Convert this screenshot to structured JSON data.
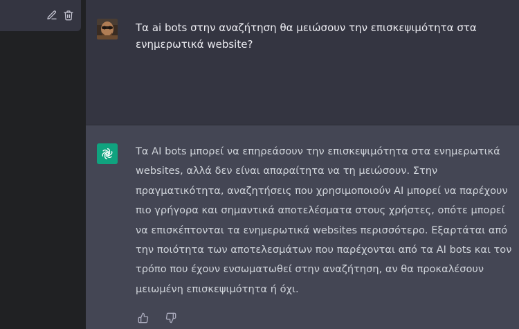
{
  "sidebar": {
    "active_item": {
      "edit_icon": "pencil-icon",
      "delete_icon": "trash-icon"
    }
  },
  "conversation": {
    "user_message": {
      "avatar": "user-avatar-photo",
      "text": "Τα ai bots στην αναζήτηση θα μειώσουν την επισκεψιμότητα στα ενημερωτικά website?"
    },
    "assistant_message": {
      "avatar": "openai-logo-icon",
      "text": "Τα AI bots μπορεί να επηρεάσουν την επισκεψιμότητα στα ενημερωτικά websites, αλλά δεν είναι απαραίτητα να τη μειώσουν. Στην πραγματικότητα, αναζητήσεις που χρησιμοποιούν AI μπορεί να παρέχουν πιο γρήγορα και σημαντικά αποτελέσματα στους χρήστες, οπότε μπορεί να επισκέπτονται τα ενημερωτικά websites περισσότερο. Εξαρτάται από την ποιότητα των αποτελεσμάτων που παρέχονται από τα AI bots και τον τρόπο που έχουν ενσωματωθεί στην αναζήτηση, αν θα προκαλέσουν μειωμένη επισκεψιμότητα ή όχι.",
      "feedback_icons": [
        "thumbs-up-icon",
        "thumbs-down-icon"
      ]
    }
  },
  "colors": {
    "sidebar_bg": "#202123",
    "main_bg": "#343541",
    "assistant_bg": "#444654",
    "assistant_avatar_bg": "#10a37f",
    "user_text": "#ececf1",
    "assistant_text": "#d1d5db"
  }
}
